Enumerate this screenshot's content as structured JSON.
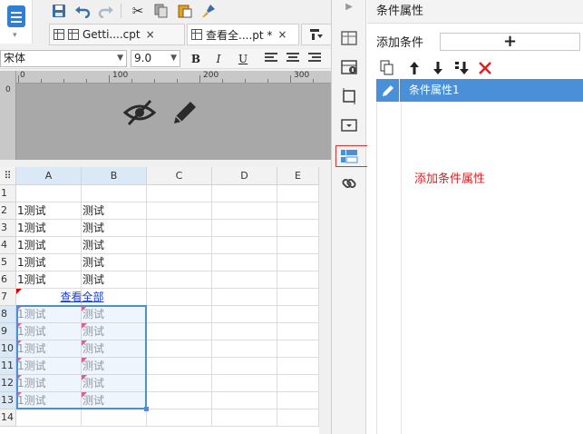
{
  "toolbar": {
    "icons": [
      "logo-icon",
      "save-icon",
      "undo-icon",
      "redo-icon",
      "cut-icon",
      "copy-icon",
      "paste-icon",
      "format-painter-icon"
    ],
    "tabs": [
      {
        "label": "Getti....cpt",
        "close": "×"
      },
      {
        "label": "查看全....pt *",
        "close": "×"
      }
    ]
  },
  "font_bar": {
    "font_family": "宋体",
    "font_size": "9.0",
    "bold": "B",
    "italic": "I",
    "underline": "U"
  },
  "ruler": {
    "ticks": [
      "0",
      "100",
      "200",
      "300"
    ],
    "side": "0"
  },
  "grid": {
    "columns": [
      "A",
      "B",
      "C",
      "D",
      "E"
    ],
    "rows": [
      "1",
      "2",
      "3",
      "4",
      "5",
      "6",
      "7",
      "8",
      "9",
      "10",
      "11",
      "12",
      "13",
      "14"
    ],
    "cells": [
      {
        "row": 2,
        "a": "1测试",
        "b": "测试"
      },
      {
        "row": 3,
        "a": "1测试",
        "b": "测试"
      },
      {
        "row": 4,
        "a": "1测试",
        "b": "测试"
      },
      {
        "row": 5,
        "a": "1测试",
        "b": "测试"
      },
      {
        "row": 6,
        "a": "1测试",
        "b": "测试"
      },
      {
        "row": 8,
        "a": "1测试",
        "b": "测试"
      },
      {
        "row": 9,
        "a": "1测试",
        "b": "测试"
      },
      {
        "row": 10,
        "a": "1测试",
        "b": "测试"
      },
      {
        "row": 11,
        "a": "1测试",
        "b": "测试"
      },
      {
        "row": 12,
        "a": "1测试",
        "b": "测试"
      },
      {
        "row": 13,
        "a": "1测试",
        "b": "测试"
      }
    ],
    "link_cell": {
      "row": 7,
      "text": "查看全部"
    }
  },
  "panel": {
    "title": "条件属性",
    "add_condition_label": "添加条件",
    "add_button": "+",
    "condition_item": "条件属性1",
    "annotation": "添加条件属性"
  },
  "colors": {
    "accent": "#4a90d9",
    "annotation": "#e02020",
    "highlight_border": "#e03030"
  }
}
